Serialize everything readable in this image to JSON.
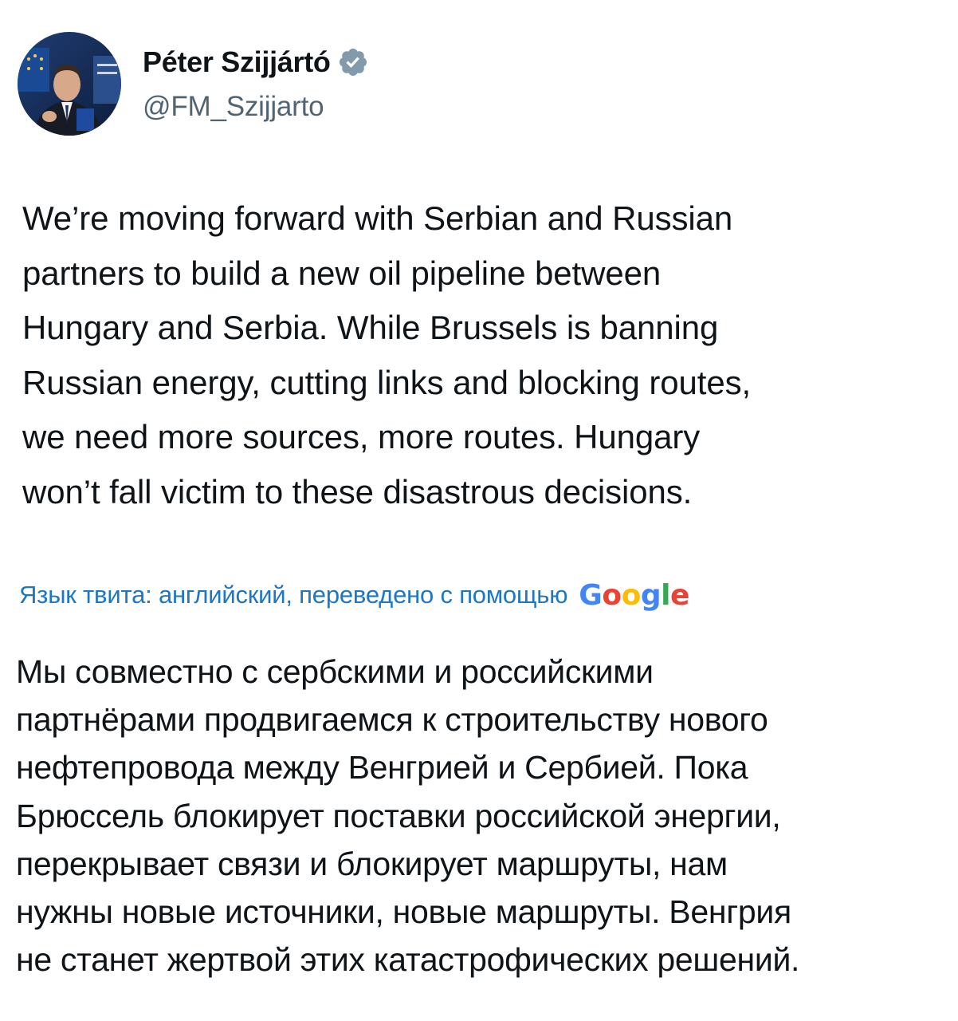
{
  "author": {
    "display_name": "Péter Szijjártó",
    "handle": "@FM_Szijjarto",
    "verified": true,
    "verified_badge_color": "#829aab",
    "avatar_icon": "profile-photo"
  },
  "tweet": {
    "text_lines": [
      "We’re moving forward with Serbian and Russian",
      "partners to build a new oil pipeline between",
      "Hungary and Serbia. While Brussels is banning",
      "Russian energy, cutting links and blocking routes,",
      "we need more sources, more routes. Hungary",
      "won’t fall victim to these disastrous decisions."
    ]
  },
  "translation": {
    "label": "Язык твита: английский, переведено с помощью",
    "provider": "Google",
    "label_color": "#1d77c2",
    "provider_colors": [
      "#4285F4",
      "#EA4335",
      "#FBBC05",
      "#4285F4",
      "#34A853",
      "#EA4335"
    ],
    "text_lines": [
      "Мы совместно с сербскими и российскими",
      "партнёрами продвигаемся к строительству нового",
      "нефтепровода между Венгрией и Сербией. Пока",
      "Брюссель блокирует поставки российской энергии,",
      "перекрывает связи и блокирует маршруты, нам",
      "нужны новые источники, новые маршруты. Венгрия",
      "не станет жертвой этих катастрофических решений."
    ]
  }
}
